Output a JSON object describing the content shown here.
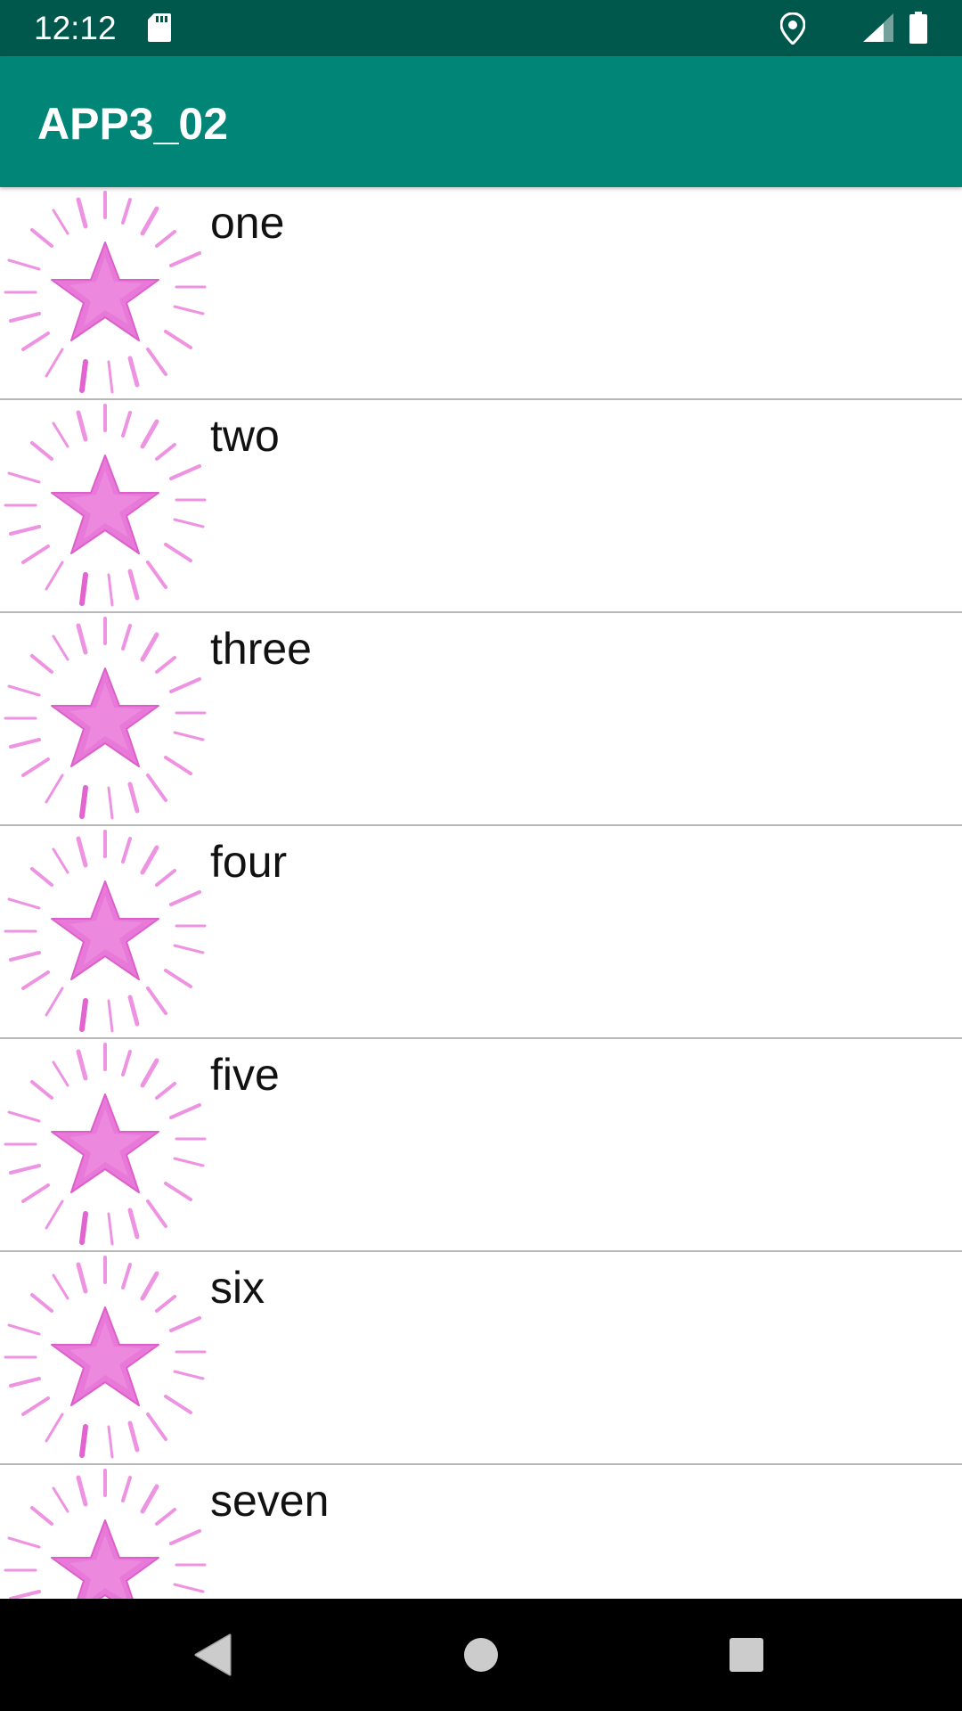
{
  "status_bar": {
    "time": "12:12",
    "icons": [
      "sd-card-icon",
      "location-icon",
      "signal-icon",
      "battery-icon"
    ]
  },
  "app_bar": {
    "title": "APP3_02"
  },
  "list": {
    "items": [
      {
        "label": "one",
        "image": "pink-star-icon"
      },
      {
        "label": "two",
        "image": "pink-star-icon"
      },
      {
        "label": "three",
        "image": "pink-star-icon"
      },
      {
        "label": "four",
        "image": "pink-star-icon"
      },
      {
        "label": "five",
        "image": "pink-star-icon"
      },
      {
        "label": "six",
        "image": "pink-star-icon"
      },
      {
        "label": "seven",
        "image": "pink-star-icon"
      }
    ]
  },
  "nav_bar": {
    "buttons": [
      "back-icon",
      "home-icon",
      "recents-icon"
    ]
  },
  "colors": {
    "status_bar": "#00574b",
    "app_bar": "#008577",
    "star": "#e879d8",
    "divider": "#b8b8b8"
  }
}
